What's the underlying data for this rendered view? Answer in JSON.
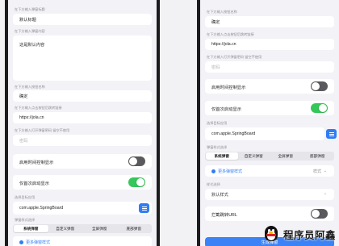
{
  "left": {
    "title_caption": "在下方输入弹窗标题",
    "title_value": "默认标题",
    "content_caption": "在下方输入弹窗内容",
    "content_value": "这是默认内容",
    "button_caption": "在下方输入按钮名称",
    "button_value": "确定",
    "link_caption": "在下方输入点击按钮后跳转链接",
    "link_value": "https://jola.cn",
    "password_caption": "在下方输入打开弹窗密码 留空不使用",
    "password_placeholder": "密码",
    "time_toggle_label": "启用时间控制显示",
    "time_toggle_on": false,
    "once_toggle_label": "仅首次启动显示",
    "once_toggle_on": true,
    "target_caption": "选择目标应用",
    "target_value": "com.apple.SpringBoard",
    "style_caption": "弹窗样式选择",
    "tabs": [
      "系统弹窗",
      "自定义弹窗",
      "全屏弹窗",
      "底部弹窗"
    ],
    "active_tab": 0,
    "more_label": "更多弹窗样式"
  },
  "right": {
    "button_caption": "在下方输入按钮名称",
    "button_value": "确定",
    "link_caption": "在下方输入点击按钮后跳转链接",
    "link_value": "https://jola.cn",
    "password_caption": "在下方输入打开弹窗密码 留空不使用",
    "password_placeholder": "密码",
    "time_toggle_label": "启用时间控制显示",
    "time_toggle_on": false,
    "once_toggle_label": "仅首次启动显示",
    "once_toggle_on": true,
    "target_caption": "选择目标应用",
    "target_value": "com.apple.SpringBoard",
    "style_caption": "弹窗样式选择",
    "tabs": [
      "系统弹窗",
      "自定义弹窗",
      "全屏弹窗",
      "底部弹窗"
    ],
    "active_tab": 0,
    "more_label": "更多弹窗样式",
    "more_value": "样式",
    "format_caption": "样式选择",
    "format_value": "默认样式",
    "url_toggle_label": "拦截跳转URL",
    "url_toggle_on": false,
    "submit_label": "生成弹窗"
  },
  "watermark": {
    "text": "程序员阿鑫",
    "icon": "penguin-icon"
  },
  "colors": {
    "accent": "#2f7cf6",
    "toggle_on": "#34c759",
    "toggle_off": "#5a5a5e",
    "background": "#f2f2f7"
  }
}
